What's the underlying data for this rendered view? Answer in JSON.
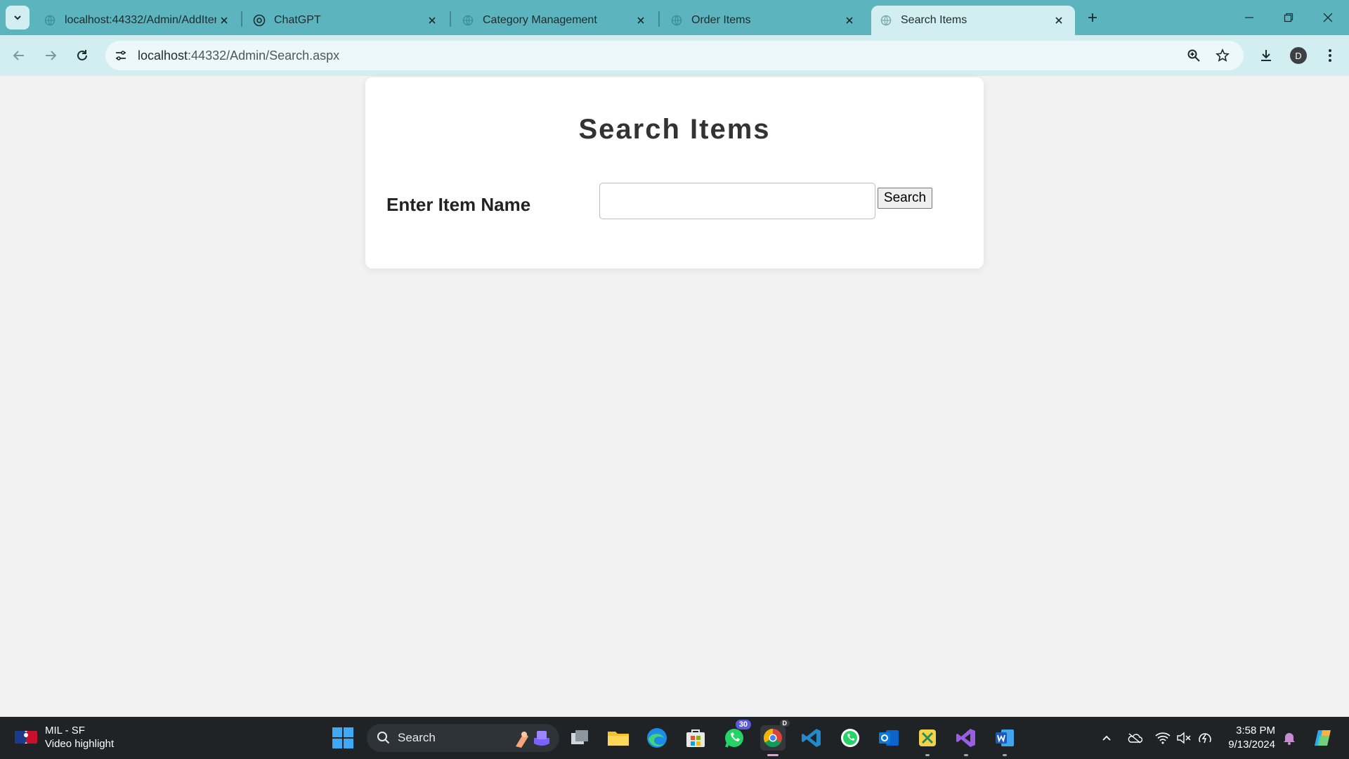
{
  "browser": {
    "tabs": [
      {
        "title": "localhost:44332/Admin/AddIter",
        "active": false
      },
      {
        "title": "ChatGPT",
        "active": false
      },
      {
        "title": "Category Management",
        "active": false
      },
      {
        "title": "Order Items",
        "active": false
      },
      {
        "title": "Search Items",
        "active": true
      }
    ],
    "url_host": "localhost",
    "url_path": ":44332/Admin/Search.aspx",
    "profile_initial": "D",
    "accent_color": "#5cb5be"
  },
  "page": {
    "title": "Search Items",
    "field_label": "Enter Item Name",
    "search_input_value": "",
    "search_button_label": "Search"
  },
  "taskbar": {
    "widget_line1": "MIL - SF",
    "widget_line2": "Video highlight",
    "search_label": "Search",
    "whatsapp_badge": "30",
    "chrome_profile_badge": "D",
    "time": "3:58 PM",
    "date": "9/13/2024"
  }
}
